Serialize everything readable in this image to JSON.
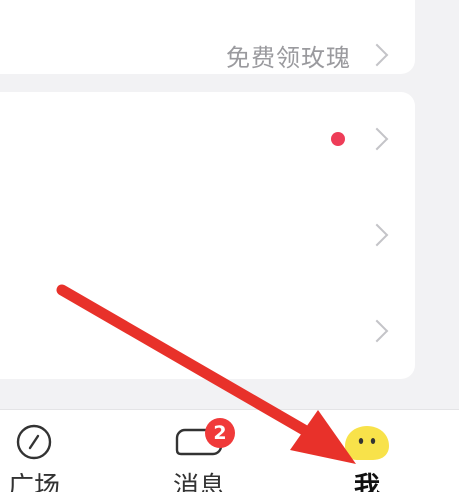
{
  "settings": {
    "promo_label": "免费领玫瑰"
  },
  "tabbar": {
    "tabs": [
      {
        "label": "广场",
        "icon": "compass-icon"
      },
      {
        "label": "消息",
        "icon": "chat-bubble-icon",
        "badge": "2"
      },
      {
        "label": "我",
        "icon": "avatar-face-icon"
      }
    ]
  },
  "colors": {
    "accent_red": "#ee3d58",
    "badge_red": "#f03a3a",
    "avatar_yellow": "#f8e24a",
    "arrow_red": "#e8312a"
  }
}
